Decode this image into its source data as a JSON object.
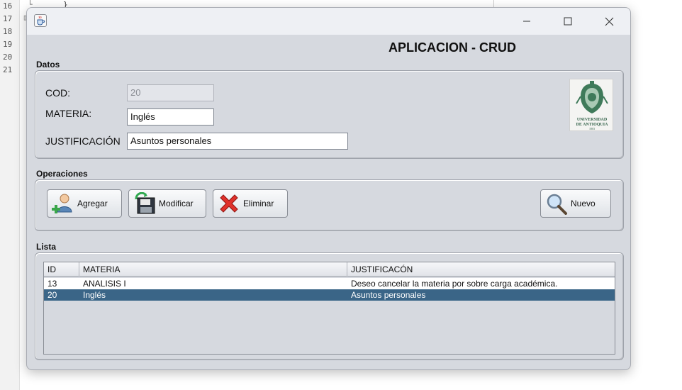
{
  "editor": {
    "line_numbers": [
      "16",
      "17",
      "18",
      "19",
      "20",
      "21"
    ],
    "code_line": "}"
  },
  "window": {
    "heading": "APLICACION - CRUD",
    "min_symbol": "—",
    "max_symbol": "☐",
    "close_symbol": "✕"
  },
  "datos": {
    "section_label": "Datos",
    "cod_label": "COD:",
    "cod_value": "20",
    "materia_label": "MATERIA:",
    "materia_value": "Inglés",
    "justificacion_label": "JUSTIFICACIÓN",
    "justificacion_value": "Asuntos personales",
    "logo_text": "UNIVERSIDAD DE ANTIOQUIA",
    "logo_year": "1803"
  },
  "operaciones": {
    "section_label": "Operaciones",
    "buttons": {
      "agregar": "Agregar",
      "modificar": "Modificar",
      "eliminar": "Eliminar",
      "nuevo": "Nuevo"
    }
  },
  "lista": {
    "section_label": "Lista",
    "columns": [
      "ID",
      "MATERIA",
      "JUSTIFICACÓN"
    ],
    "rows": [
      {
        "id": "13",
        "materia": "ANALISIS I",
        "justificacion": "Deseo cancelar la materia por sobre carga académica."
      },
      {
        "id": "20",
        "materia": "Inglés",
        "justificacion": "Asuntos personales"
      }
    ],
    "selected_row": 1
  },
  "colors": {
    "selection": "#3a6587",
    "window_bg": "#d6d9df"
  },
  "icons": {
    "app": "java-cup-icon",
    "agregar": "add-user-icon",
    "modificar": "save-disk-icon",
    "eliminar": "red-x-icon",
    "nuevo": "magnifier-icon"
  }
}
